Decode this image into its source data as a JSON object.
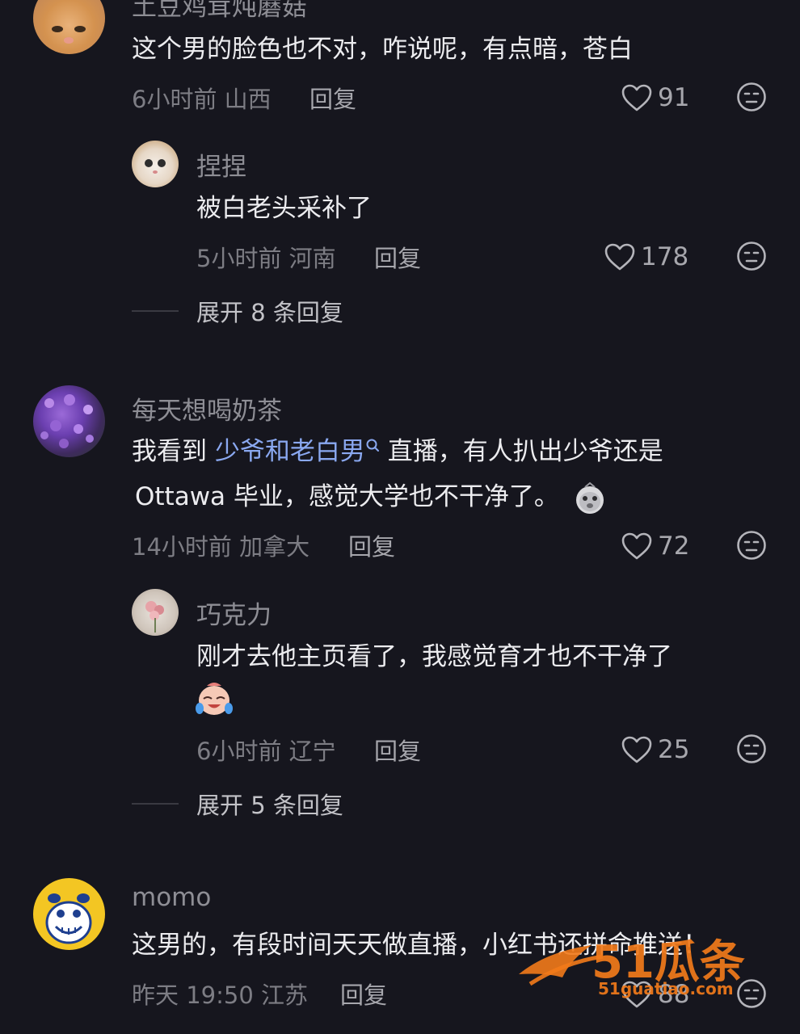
{
  "comments": [
    {
      "username": "土豆鸡茸炖蘑菇",
      "text": "这个男的脸色也不对，咋说呢，有点暗，苍白",
      "time_location": "6小时前 山西",
      "reply_label": "回复",
      "likes": "91",
      "replies": [
        {
          "username": "捏捏",
          "text": "被白老头采补了",
          "time_location": "5小时前 河南",
          "reply_label": "回复",
          "likes": "178"
        }
      ],
      "expand_label": "展开 8 条回复"
    },
    {
      "username": "每天想喝奶茶",
      "text_before_link": "我看到 ",
      "link_text": "少爷和老白男",
      "text_after_link": " 直播，有人扒出少爷还是",
      "text_line2": "Ottawa 毕业，感觉大学也不干净了。",
      "time_location": "14小时前 加拿大",
      "reply_label": "回复",
      "likes": "72",
      "replies": [
        {
          "username": "巧克力",
          "text": "刚才去他主页看了，我感觉育才也不干净了",
          "time_location": "6小时前 辽宁",
          "reply_label": "回复",
          "likes": "25"
        }
      ],
      "expand_label": "展开 5 条回复"
    },
    {
      "username": "momo",
      "text": "这男的，有段时间天天做直播，小红书还拼命推送！",
      "time_location": "昨天 19:50 江苏",
      "reply_label": "回复",
      "likes": "88"
    }
  ],
  "watermark": {
    "brand": "51瓜条",
    "url": "51guatiao.com"
  },
  "icons": {
    "like": "heart-outline-icon",
    "dislike": "neutral-face-icon",
    "search": "search-icon"
  },
  "colors": {
    "background": "#16161e",
    "link": "#8aa8f0",
    "watermark": "#f27a1a"
  }
}
